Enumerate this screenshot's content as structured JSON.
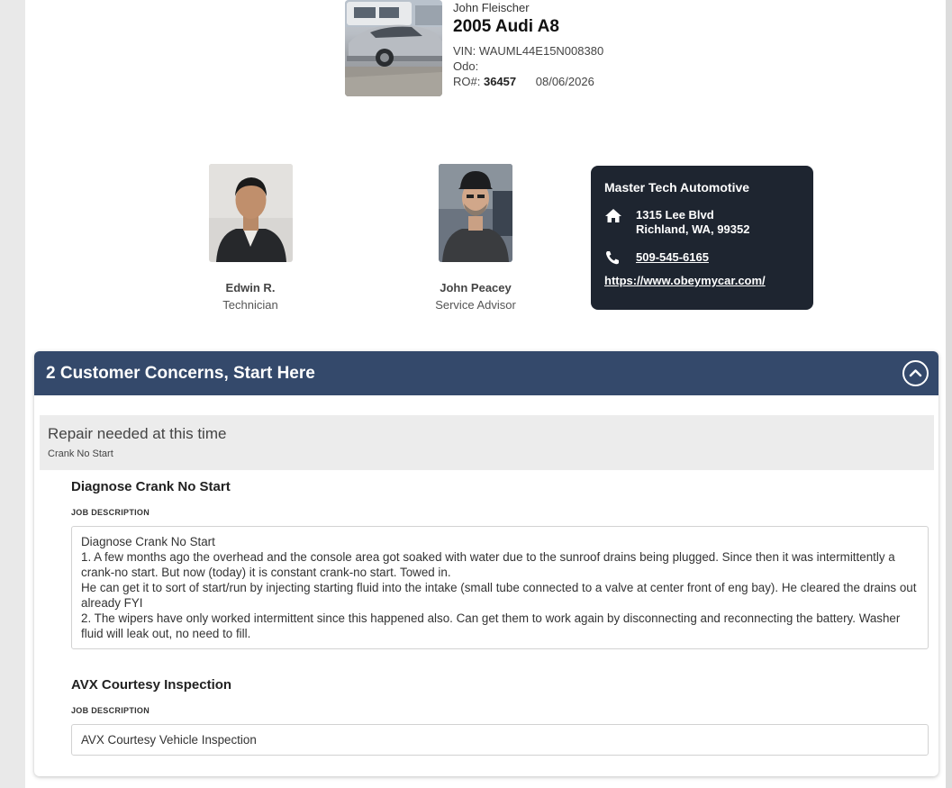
{
  "vehicle": {
    "customer_name": "John Fleischer",
    "title": "2005 Audi A8",
    "vin_label": "VIN:",
    "vin": "WAUML44E15N008380",
    "odo_label": "Odo:",
    "odo": "",
    "ro_label": "RO#:",
    "ro_number": "36457",
    "date": "08/06/2026"
  },
  "technician": {
    "name": "Edwin R.",
    "role": "Technician"
  },
  "advisor": {
    "name": "John Peacey",
    "role": "Service Advisor"
  },
  "shop": {
    "name": "Master Tech Automotive",
    "address_line1": "1315 Lee Blvd",
    "address_line2": "Richland, WA, 99352",
    "phone": "509-545-6165",
    "website": "https://www.obeymycar.com/",
    "icons": [
      "home-icon",
      "phone-icon"
    ]
  },
  "panel": {
    "header": "2 Customer Concerns, Start Here",
    "collapse_icon": "chevron-up-icon",
    "concern": {
      "title": "Repair needed at this time",
      "subtitle": "Crank No Start"
    },
    "jobs": [
      {
        "title": "Diagnose Crank No Start",
        "desc_label": "JOB DESCRIPTION",
        "description": "Diagnose Crank No Start\n1. A few months ago the overhead and the console area got soaked with water due to the sunroof drains being plugged. Since then it was intermittently a crank-no start. But now (today) it is constant crank-no start. Towed in.\nHe can get it to sort of start/run by injecting starting fluid into the intake (small tube connected to a valve at center front of eng bay). He cleared the drains out already FYI\n2. The wipers have only worked intermittent since this happened also. Can get them to work again by disconnecting and reconnecting the battery. Washer fluid will leak out, no need to fill."
      },
      {
        "title": "AVX Courtesy Inspection",
        "desc_label": "JOB DESCRIPTION",
        "description": "AVX Courtesy Vehicle Inspection"
      }
    ]
  },
  "colors": {
    "panel_header": "#34496b",
    "shop_card": "#1e2530",
    "concern_bg": "#ececec"
  }
}
